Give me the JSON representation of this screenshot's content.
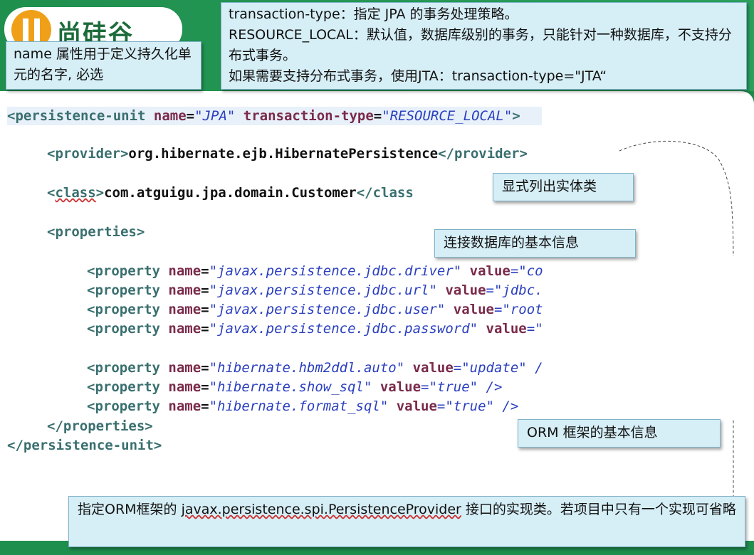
{
  "logo": {
    "text": "尚硅谷"
  },
  "callouts": {
    "name_attr": "name 属性用于定义持久化单元的名字, 必选",
    "transaction_lines": [
      "transaction-type：指定 JPA 的事务处理策略。",
      "RESOURCE_LOCAL：默认值，数据库级别的事务，只能针对一种数据库，不支持分布式事务。",
      "如果需要支持分布式事务，使用JTA：transaction-type=\"JTA“"
    ],
    "entity_class": "显式列出实体类",
    "db_info": "连接数据库的基本信息",
    "orm_info": "ORM 框架的基本信息",
    "provider_prefix": "指定ORM框架的 ",
    "provider_interface": "javax.persistence.spi.PersistenceProvider",
    "provider_suffix": " 接口的实现类。若项目中只有一个实现可省略"
  },
  "code": {
    "unit_open": {
      "tag_open": "<persistence-unit ",
      "attr1": "name",
      "eq1": "=",
      "val1": "\"JPA\"",
      "attr2": " transaction-type",
      "eq2": "=",
      "val2": "\"RESOURCE_LOCAL\"",
      "close": ">"
    },
    "provider": {
      "open": "<provider>",
      "text": "org.hibernate.ejb.HibernatePersistence",
      "close": "</provider>"
    },
    "class_line": {
      "lt": "<",
      "name": "class",
      "gt": ">",
      "text": "com.atguigu.jpa.domain.Customer",
      "close": "</class"
    },
    "properties_open": "<properties>",
    "props": [
      {
        "name": "\"javax.persistence.jdbc.driver\"",
        "value_label": " value",
        "value": "=\"co"
      },
      {
        "name": "\"javax.persistence.jdbc.url\"",
        "value_label": " value",
        "value": "=\"jdbc."
      },
      {
        "name": "\"javax.persistence.jdbc.user\"",
        "value_label": " value",
        "value": "=\"root"
      },
      {
        "name": "\"javax.persistence.jdbc.password\"",
        "value_label": " value",
        "value": "=\""
      },
      {
        "name": "\"hibernate.hbm2ddl.auto\"",
        "value_label": " value",
        "value": "=\"update\" /"
      },
      {
        "name": "\"hibernate.show_sql\"",
        "value_label": " value",
        "value": "=\"true\" />"
      },
      {
        "name": "\"hibernate.format_sql\"",
        "value_label": " value",
        "value": "=\"true\" />"
      }
    ],
    "property_tag": "<property ",
    "name_label": "name",
    "properties_close": "</properties>",
    "unit_close": "</persistence-unit>"
  }
}
